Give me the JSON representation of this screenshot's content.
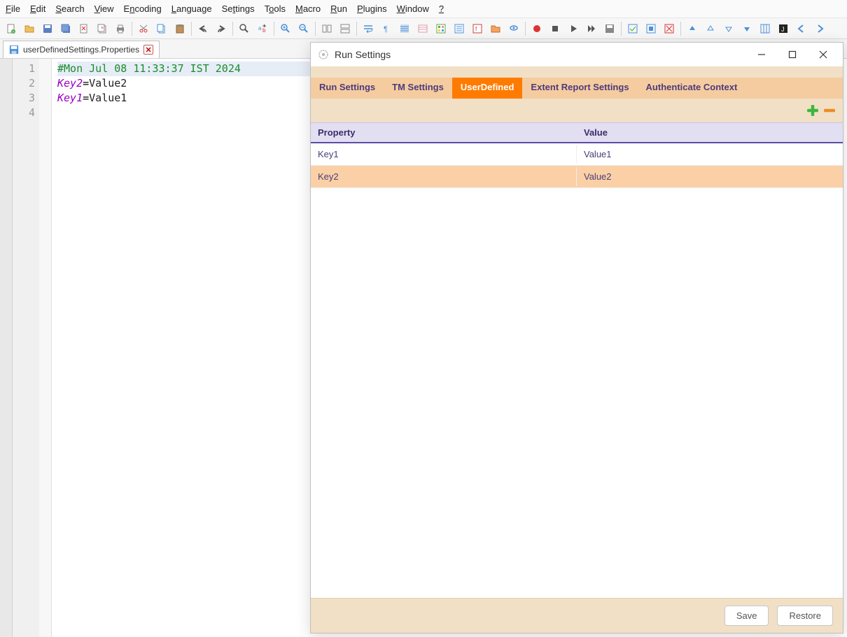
{
  "menubar": {
    "items": [
      {
        "label": "File",
        "ul": "F"
      },
      {
        "label": "Edit",
        "ul": "E"
      },
      {
        "label": "Search",
        "ul": "S"
      },
      {
        "label": "View",
        "ul": "V"
      },
      {
        "label": "Encoding",
        "ul": "n"
      },
      {
        "label": "Language",
        "ul": "L"
      },
      {
        "label": "Settings",
        "ul": "t"
      },
      {
        "label": "Tools",
        "ul": "o"
      },
      {
        "label": "Macro",
        "ul": "M"
      },
      {
        "label": "Run",
        "ul": "R"
      },
      {
        "label": "Plugins",
        "ul": "P"
      },
      {
        "label": "Window",
        "ul": "W"
      },
      {
        "label": "?",
        "ul": "?"
      }
    ]
  },
  "tab": {
    "filename": "userDefinedSettings.Properties"
  },
  "editor": {
    "line_numbers": [
      "1",
      "2",
      "3",
      "4"
    ],
    "line1_comment": "#Mon Jul 08 11:33:37 IST 2024",
    "line2_key": "Key2",
    "line2_eq": "=",
    "line2_val": "Value2",
    "line3_key": "Key1",
    "line3_eq": "=",
    "line3_val": "Value1"
  },
  "modal": {
    "title": "Run Settings",
    "tabs": [
      {
        "label": "Run Settings"
      },
      {
        "label": "TM Settings"
      },
      {
        "label": "UserDefined",
        "active": true
      },
      {
        "label": "Extent Report Settings"
      },
      {
        "label": "Authenticate Context"
      }
    ],
    "grid": {
      "header_property": "Property",
      "header_value": "Value",
      "rows": [
        {
          "property": "Key1",
          "value": "Value1"
        },
        {
          "property": "Key2",
          "value": "Value2"
        }
      ]
    },
    "buttons": {
      "save": "Save",
      "restore": "Restore"
    }
  }
}
